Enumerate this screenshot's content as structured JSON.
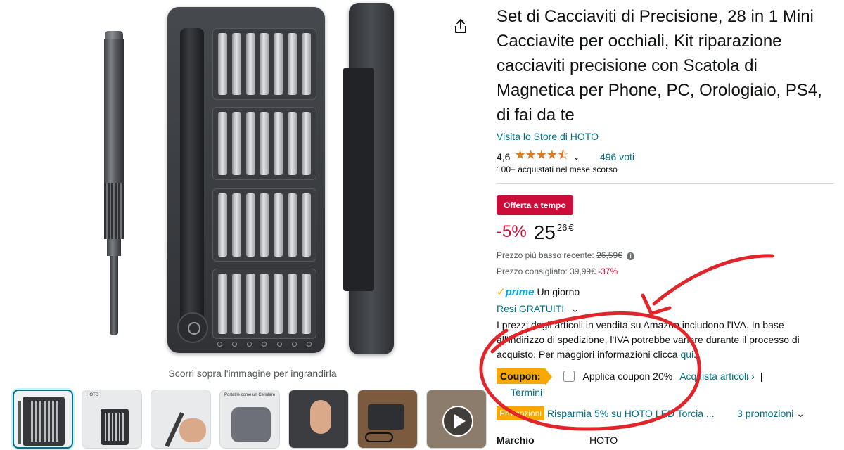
{
  "gallery": {
    "zoom_hint": "Scorri sopra l'immagine per ingrandirla",
    "thumbnails": [
      {
        "name": "thumb-product-front",
        "text": ""
      },
      {
        "name": "thumb-open-case",
        "text": "HOTO"
      },
      {
        "name": "thumb-in-hand",
        "text": ""
      },
      {
        "name": "thumb-portable",
        "text": "Portatile come un Cellulare"
      },
      {
        "name": "thumb-magnetic-bits",
        "text": ""
      },
      {
        "name": "thumb-on-desk",
        "text": ""
      },
      {
        "name": "thumb-video",
        "text": ""
      }
    ]
  },
  "product": {
    "title": "Set di Cacciaviti di Precisione, 28 in 1 Mini Cacciavite per occhiali, Kit riparazione cacciaviti precisione con Scatola di Magnetica per Phone, PC, Orologiaio, PS4, di fai da te",
    "store_link": "Visita lo Store di HOTO",
    "rating": "4,6",
    "stars": "★★★★⯪",
    "votes": "496 voti",
    "sold": "100+ acquistati nel mese scorso"
  },
  "pricing": {
    "deal_badge": "Offerta a tempo",
    "discount": "-5%",
    "price_whole": "25",
    "price_fraction": "26",
    "currency": "€",
    "lowest_label": "Prezzo più basso recente:",
    "lowest_value": "26,59€",
    "list_label": "Prezzo consigliato:",
    "list_value": "39,99€",
    "list_discount": "-37%"
  },
  "delivery": {
    "prime_check": "✓",
    "prime_word": "prime",
    "prime_when": "Un giorno",
    "returns": "Resi GRATUITI"
  },
  "vat_notice": {
    "text": "I prezzi degli articoli in vendita su Amazon includono l'IVA. In base all'indirizzo di spedizione, l'IVA potrebbe variare durante il processo di acquisto. Per maggiori informazioni clicca ",
    "link": "qui",
    "end": "."
  },
  "coupon": {
    "badge": "Coupon:",
    "label": "Applica coupon 20%",
    "link": "Acquista articoli ›",
    "pipe": "|",
    "terms": "Termini"
  },
  "promotions": {
    "badge": "Promozioni",
    "text": "Risparmia 5% su HOTO LED Torcia ...",
    "count": "3 promozioni"
  },
  "specs": {
    "brand_label": "Marchio",
    "brand_value": "HOTO"
  },
  "colors": {
    "link": "#007185",
    "deal_red": "#cc0c39",
    "coupon_orange": "#f7a800",
    "annotation_red": "#e0262b",
    "prime_blue": "#00a8e1"
  }
}
